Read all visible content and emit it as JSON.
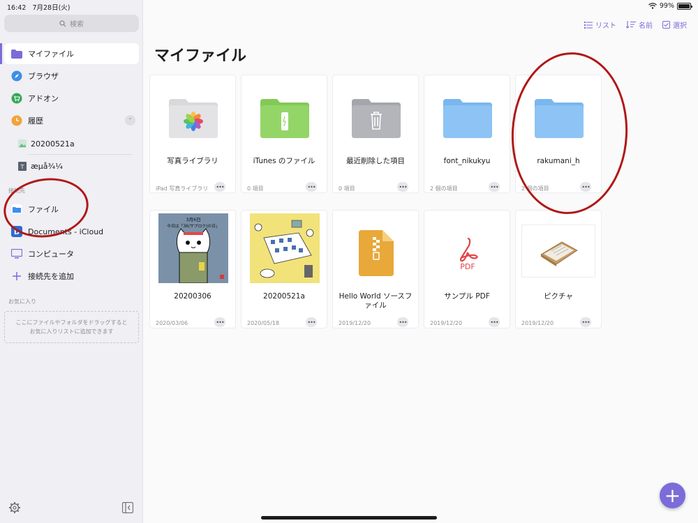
{
  "status": {
    "time": "16:42",
    "date": "7月28日(火)",
    "battery": "99%",
    "battery_level": 0.99
  },
  "sidebar": {
    "search_placeholder": "検索",
    "items": [
      {
        "label": "マイファイル",
        "icon": "folder-icon"
      },
      {
        "label": "ブラウザ",
        "icon": "compass-icon"
      },
      {
        "label": "アドオン",
        "icon": "cart-icon"
      },
      {
        "label": "履歴",
        "icon": "clock-icon"
      }
    ],
    "history": [
      {
        "label": "20200521a",
        "icon": "image-icon"
      },
      {
        "label": "æµå¾¼",
        "icon": "text-file-icon"
      }
    ],
    "connections_label": "接続先",
    "connections": [
      {
        "label": "ファイル",
        "icon": "files-app-icon"
      },
      {
        "label": "Documents - iCloud",
        "icon": "documents-icon"
      },
      {
        "label": "コンピュータ",
        "icon": "computer-icon"
      },
      {
        "label": "接続先を追加",
        "icon": "plus-icon"
      }
    ],
    "favorites_label": "お気に入り",
    "favorites_hint": "ここにファイルやフォルダをドラッグすると\nお気に入りリストに追加できます"
  },
  "toolbar": {
    "list_label": "リスト",
    "sort_label": "名前",
    "select_label": "選択"
  },
  "main": {
    "title": "マイファイル",
    "items": [
      {
        "name": "写真ライブラリ",
        "meta": "iPad 写真ライブラリ",
        "kind": "photos-folder"
      },
      {
        "name": "iTunes のファイル",
        "meta": "0 項目",
        "kind": "itunes-folder"
      },
      {
        "name": "最近削除した項目",
        "meta": "0 項目",
        "kind": "trash-folder"
      },
      {
        "name": "font_nikukyu",
        "meta": "2 個の項目",
        "kind": "folder"
      },
      {
        "name": "rakumani_h",
        "meta": "2 個の項目",
        "kind": "folder"
      },
      {
        "name": "20200306",
        "meta": "2020/03/06",
        "kind": "image-cat"
      },
      {
        "name": "20200521a",
        "meta": "2020/05/18",
        "kind": "image-illust"
      },
      {
        "name": "Hello World ソースファイル",
        "meta": "2019/12/20",
        "kind": "zip"
      },
      {
        "name": "サンプル PDF",
        "meta": "2019/12/20",
        "kind": "pdf"
      },
      {
        "name": "ピクチャ",
        "meta": "2019/12/20",
        "kind": "picture"
      }
    ],
    "thumb_text": {
      "cat_line1": "3月6日",
      "cat_line2": "今日は「36(サブロク)の日」",
      "pdf_label": "PDF"
    }
  },
  "colors": {
    "accent": "#7b6cd9",
    "folder_blue": "#8ec3f5",
    "annotation_red": "#b01818"
  }
}
